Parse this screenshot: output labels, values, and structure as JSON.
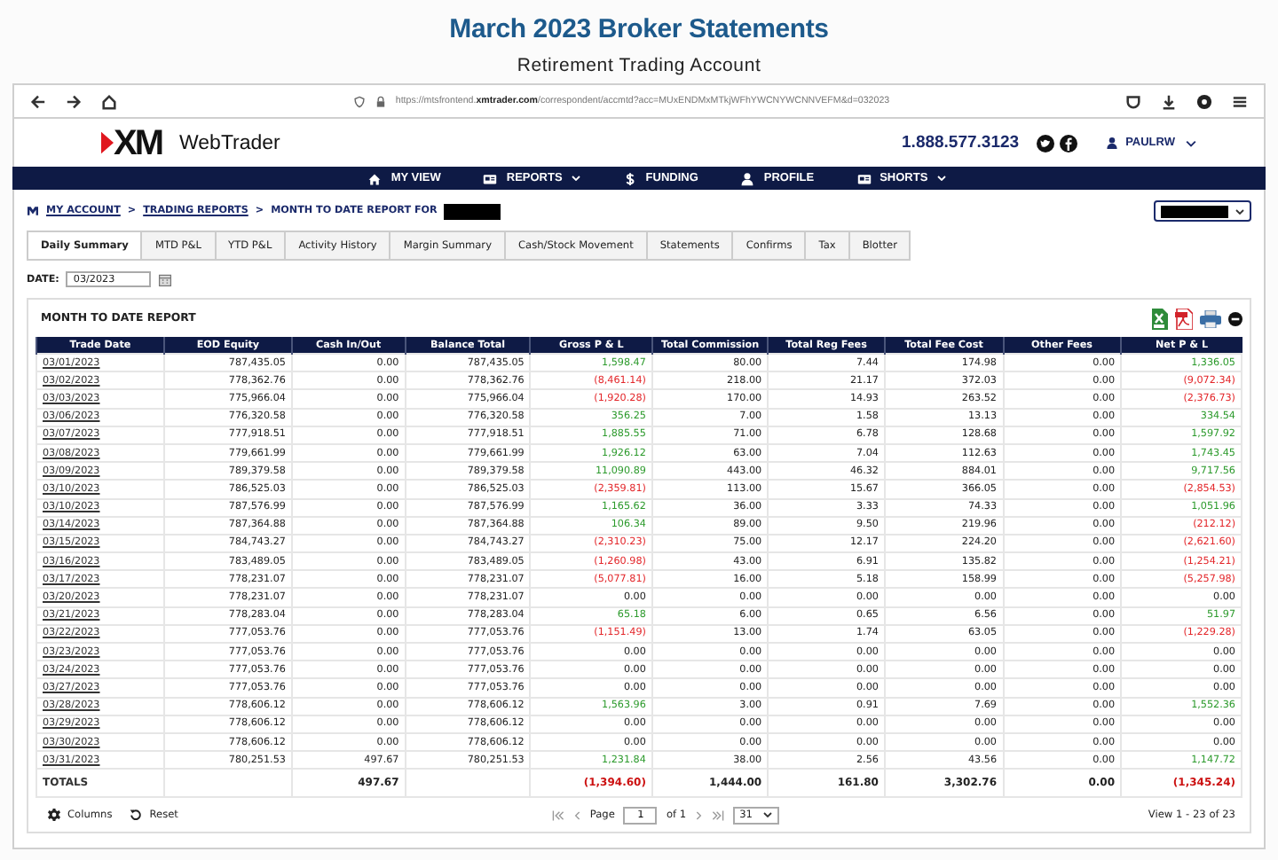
{
  "heading": {
    "title": "March 2023 Broker Statements",
    "subtitle": "Retirement Trading Account"
  },
  "browser": {
    "url": "https://mtsfrontend.**xmtrader.com**/correspondent/accmtd?acc=MUxENDMxMTkjWFhYWCNYWCNNVEFM&d=032023"
  },
  "header": {
    "logo": "XM",
    "brand": "WebTrader",
    "phone": "1.888.577.3123",
    "user": "PAULRW"
  },
  "nav": [
    {
      "label": "MY VIEW",
      "kind": "home",
      "dropdown": false
    },
    {
      "label": "REPORTS",
      "kind": "card",
      "dropdown": true
    },
    {
      "label": "FUNDING",
      "kind": "dollar",
      "dropdown": false
    },
    {
      "label": "PROFILE",
      "kind": "person",
      "dropdown": false
    },
    {
      "label": "SHORTS",
      "kind": "card",
      "dropdown": true
    }
  ],
  "breadcrumb": {
    "items": [
      {
        "label": "MY ACCOUNT",
        "link": true
      },
      {
        "label": "TRADING REPORTS",
        "link": true
      },
      {
        "label": "MONTH TO DATE REPORT FOR",
        "link": false
      }
    ],
    "separator": ">"
  },
  "tabs": [
    {
      "label": "Daily Summary",
      "selected": true
    },
    {
      "label": "MTD P&L",
      "selected": false
    },
    {
      "label": "YTD P&L",
      "selected": false
    },
    {
      "label": "Activity History",
      "selected": false
    },
    {
      "label": "Margin Summary",
      "selected": false
    },
    {
      "label": "Cash/Stock Movement",
      "selected": false
    },
    {
      "label": "Statements",
      "selected": false
    },
    {
      "label": "Confirms",
      "selected": false
    },
    {
      "label": "Tax",
      "selected": false
    },
    {
      "label": "Blotter",
      "selected": false
    }
  ],
  "date": {
    "label": "DATE:",
    "value": "03/2023"
  },
  "report": {
    "title": "MONTH TO DATE REPORT"
  },
  "columns": [
    "Trade Date",
    "EOD Equity",
    "Cash In/Out",
    "Balance Total",
    "Gross P & L",
    "Total Commission",
    "Total Reg Fees",
    "Total Fee Cost",
    "Other Fees",
    "Net P & L"
  ],
  "rows": [
    {
      "cells": [
        "03/01/2023",
        "787,435.05",
        "0.00",
        "787,435.05",
        {
          "text": "1,598.47",
          "color": "#2c9a2c"
        },
        "80.00",
        "7.44",
        "174.98",
        "0.00",
        {
          "text": "1,336.05",
          "color": "#2c9a2c"
        }
      ]
    },
    {
      "cells": [
        "03/02/2023",
        "778,362.76",
        "0.00",
        "778,362.76",
        {
          "text": "(8,461.14)",
          "color": "#e3262a"
        },
        "218.00",
        "21.17",
        "372.03",
        "0.00",
        {
          "text": "(9,072.34)",
          "color": "#e3262a"
        }
      ]
    },
    {
      "cells": [
        "03/03/2023",
        "775,966.04",
        "0.00",
        "775,966.04",
        {
          "text": "(1,920.28)",
          "color": "#e3262a"
        },
        "170.00",
        "14.93",
        "263.52",
        "0.00",
        {
          "text": "(2,376.73)",
          "color": "#e3262a"
        }
      ]
    },
    {
      "cells": [
        "03/06/2023",
        "776,320.58",
        "0.00",
        "776,320.58",
        {
          "text": "356.25",
          "color": "#2c9a2c"
        },
        "7.00",
        "1.58",
        "13.13",
        "0.00",
        {
          "text": "334.54",
          "color": "#2c9a2c"
        }
      ]
    },
    {
      "cells": [
        "03/07/2023",
        "777,918.51",
        "0.00",
        "777,918.51",
        {
          "text": "1,885.55",
          "color": "#2c9a2c"
        },
        "71.00",
        "6.78",
        "128.68",
        "0.00",
        {
          "text": "1,597.92",
          "color": "#2c9a2c"
        }
      ]
    },
    {
      "cells": [
        "03/08/2023",
        "779,661.99",
        "0.00",
        "779,661.99",
        {
          "text": "1,926.12",
          "color": "#2c9a2c"
        },
        "63.00",
        "7.04",
        "112.63",
        "0.00",
        {
          "text": "1,743.45",
          "color": "#2c9a2c"
        }
      ]
    },
    {
      "cells": [
        "03/09/2023",
        "789,379.58",
        "0.00",
        "789,379.58",
        {
          "text": "11,090.89",
          "color": "#2c9a2c"
        },
        "443.00",
        "46.32",
        "884.01",
        "0.00",
        {
          "text": "9,717.56",
          "color": "#2c9a2c"
        }
      ]
    },
    {
      "cells": [
        "03/10/2023",
        "786,525.03",
        "0.00",
        "786,525.03",
        {
          "text": "(2,359.81)",
          "color": "#e3262a"
        },
        "113.00",
        "15.67",
        "366.05",
        "0.00",
        {
          "text": "(2,854.53)",
          "color": "#e3262a"
        }
      ]
    },
    {
      "cells": [
        "03/10/2023",
        "787,576.99",
        "0.00",
        "787,576.99",
        {
          "text": "1,165.62",
          "color": "#2c9a2c"
        },
        "36.00",
        "3.33",
        "74.33",
        "0.00",
        {
          "text": "1,051.96",
          "color": "#2c9a2c"
        }
      ]
    },
    {
      "cells": [
        "03/14/2023",
        "787,364.88",
        "0.00",
        "787,364.88",
        {
          "text": "106.34",
          "color": "#2c9a2c"
        },
        "89.00",
        "9.50",
        "219.96",
        "0.00",
        {
          "text": "(212.12)",
          "color": "#e3262a"
        }
      ]
    },
    {
      "cells": [
        "03/15/2023",
        "784,743.27",
        "0.00",
        "784,743.27",
        {
          "text": "(2,310.23)",
          "color": "#e3262a"
        },
        "75.00",
        "12.17",
        "224.20",
        "0.00",
        {
          "text": "(2,621.60)",
          "color": "#e3262a"
        }
      ]
    },
    {
      "cells": [
        "03/16/2023",
        "783,489.05",
        "0.00",
        "783,489.05",
        {
          "text": "(1,260.98)",
          "color": "#e3262a"
        },
        "43.00",
        "6.91",
        "135.82",
        "0.00",
        {
          "text": "(1,254.21)",
          "color": "#e3262a"
        }
      ]
    },
    {
      "cells": [
        "03/17/2023",
        "778,231.07",
        "0.00",
        "778,231.07",
        {
          "text": "(5,077.81)",
          "color": "#e3262a"
        },
        "16.00",
        "5.18",
        "158.99",
        "0.00",
        {
          "text": "(5,257.98)",
          "color": "#e3262a"
        }
      ]
    },
    {
      "cells": [
        "03/20/2023",
        "778,231.07",
        "0.00",
        "778,231.07",
        "0.00",
        "0.00",
        "0.00",
        "0.00",
        "0.00",
        "0.00"
      ]
    },
    {
      "cells": [
        "03/21/2023",
        "778,283.04",
        "0.00",
        "778,283.04",
        {
          "text": "65.18",
          "color": "#2c9a2c"
        },
        "6.00",
        "0.65",
        "6.56",
        "0.00",
        {
          "text": "51.97",
          "color": "#2c9a2c"
        }
      ]
    },
    {
      "cells": [
        "03/22/2023",
        "777,053.76",
        "0.00",
        "777,053.76",
        {
          "text": "(1,151.49)",
          "color": "#e3262a"
        },
        "13.00",
        "1.74",
        "63.05",
        "0.00",
        {
          "text": "(1,229.28)",
          "color": "#e3262a"
        }
      ]
    },
    {
      "cells": [
        "03/23/2023",
        "777,053.76",
        "0.00",
        "777,053.76",
        "0.00",
        "0.00",
        "0.00",
        "0.00",
        "0.00",
        "0.00"
      ]
    },
    {
      "cells": [
        "03/24/2023",
        "777,053.76",
        "0.00",
        "777,053.76",
        "0.00",
        "0.00",
        "0.00",
        "0.00",
        "0.00",
        "0.00"
      ]
    },
    {
      "cells": [
        "03/27/2023",
        "777,053.76",
        "0.00",
        "777,053.76",
        "0.00",
        "0.00",
        "0.00",
        "0.00",
        "0.00",
        "0.00"
      ]
    },
    {
      "cells": [
        "03/28/2023",
        "778,606.12",
        "0.00",
        "778,606.12",
        {
          "text": "1,563.96",
          "color": "#2c9a2c"
        },
        "3.00",
        "0.91",
        "7.69",
        "0.00",
        {
          "text": "1,552.36",
          "color": "#2c9a2c"
        }
      ]
    },
    {
      "cells": [
        "03/29/2023",
        "778,606.12",
        "0.00",
        "778,606.12",
        "0.00",
        "0.00",
        "0.00",
        "0.00",
        "0.00",
        "0.00"
      ]
    },
    {
      "cells": [
        "03/30/2023",
        "778,606.12",
        "0.00",
        "778,606.12",
        "0.00",
        "0.00",
        "0.00",
        "0.00",
        "0.00",
        "0.00"
      ]
    },
    {
      "cells": [
        "03/31/2023",
        "780,251.53",
        "497.67",
        "780,251.53",
        {
          "text": "1,231.84",
          "color": "#2c9a2c"
        },
        "38.00",
        "2.56",
        "43.56",
        "0.00",
        {
          "text": "1,147.72",
          "color": "#2c9a2c"
        }
      ]
    }
  ],
  "totals": {
    "label": "TOTALS",
    "cash": "497.67",
    "gross": {
      "text": "(1,394.60)",
      "color": "#cc1111"
    },
    "commission": "1,444.00",
    "reg_fees": "161.80",
    "fee_cost": "3,302.76",
    "other": "0.00",
    "net": {
      "text": "(1,345.24)",
      "color": "#cc1111"
    }
  },
  "footer": {
    "columns": "Columns",
    "reset": "Reset",
    "page_label": "Page",
    "page": "1",
    "page_of": "of 1",
    "page_size": "31",
    "view": "View 1 - 23 of 23"
  }
}
